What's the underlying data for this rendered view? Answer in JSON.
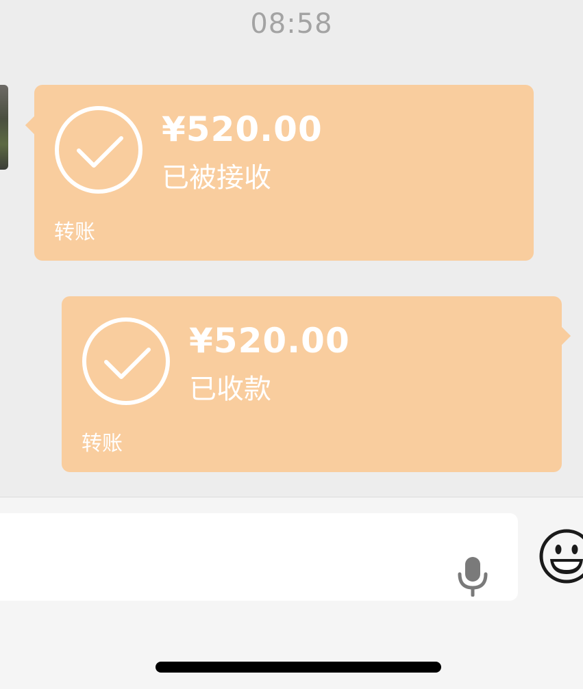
{
  "header": {
    "time": "08:58"
  },
  "messages": [
    {
      "direction": "received",
      "amount": "¥520.00",
      "status": "已被接收",
      "type_label": "转账",
      "icon": "check-circle-icon"
    },
    {
      "direction": "sent",
      "amount": "¥520.00",
      "status": "已收款",
      "type_label": "转账",
      "icon": "check-circle-icon"
    }
  ],
  "input_bar": {
    "voice_icon": "microphone-icon",
    "emoji_icon": "smiley-face-icon"
  },
  "colors": {
    "background": "#ededed",
    "transfer_bubble": "#f9cd9e",
    "text_on_bubble": "#ffffff"
  }
}
